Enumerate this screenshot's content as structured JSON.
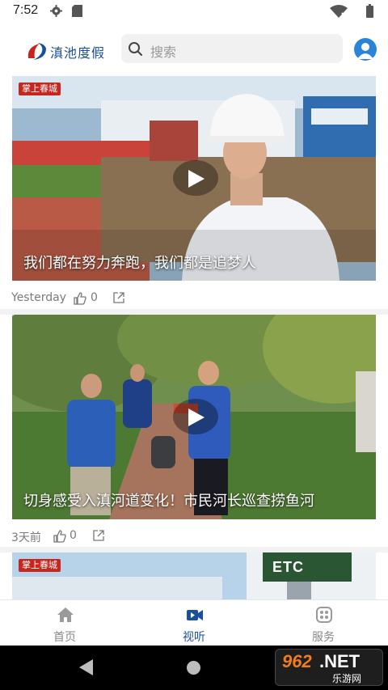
{
  "status_bar": {
    "time": "7:52",
    "icons": [
      "gear-icon",
      "sd-card-icon",
      "wifi-icon",
      "battery-icon"
    ]
  },
  "header": {
    "logo_text": "滇池度假",
    "search_placeholder": "搜索",
    "avatar_icon": "user-avatar-icon"
  },
  "feed": [
    {
      "title": "我们都在努力奔跑，我们都是追梦人",
      "time": "Yesterday",
      "likes": "0",
      "watermark": "掌上春城"
    },
    {
      "title": "切身感受入滇河道变化！市民河长巡查捞鱼河",
      "time": "3天前",
      "likes": "0"
    },
    {
      "watermark": "掌上春城",
      "sign_text": "ETC"
    }
  ],
  "bottom_nav": [
    {
      "label": "首页",
      "icon": "home-icon",
      "active": false
    },
    {
      "label": "视听",
      "icon": "video-camera-icon",
      "active": true
    },
    {
      "label": "服务",
      "icon": "service-icon",
      "active": false
    }
  ],
  "brand_badge": {
    "main": "962",
    "net": ".NET",
    "sub": "乐游网"
  },
  "colors": {
    "accent": "#1a4f9a",
    "avatar": "#2a84d8",
    "watermark_red": "#c7261f"
  }
}
